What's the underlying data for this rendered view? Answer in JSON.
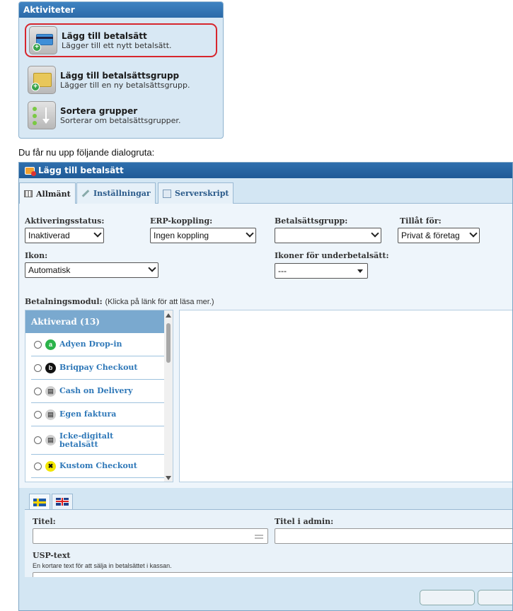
{
  "activities": {
    "header": "Aktiviteter",
    "items": [
      {
        "title": "Lägg till betalsätt",
        "desc": "Lägger till ett nytt betalsätt.",
        "icon": "card-add-icon"
      },
      {
        "title": "Lägg till betalsättsgrupp",
        "desc": "Lägger till en ny betalsättsgrupp.",
        "icon": "folder-add-icon"
      },
      {
        "title": "Sortera grupper",
        "desc": "Sorterar om betalsättsgrupper.",
        "icon": "sort-icon"
      }
    ]
  },
  "intro_text": "Du får nu upp följande dialogruta:",
  "dialog": {
    "title": "Lägg till betalsätt",
    "tabs": [
      {
        "label": "Allmänt",
        "icon": "grid-icon"
      },
      {
        "label": "Inställningar",
        "icon": "wrench-icon"
      },
      {
        "label": "Serverskript",
        "icon": "script-icon"
      }
    ],
    "fields": {
      "activation_label": "Aktiveringsstatus:",
      "activation_value": "Inaktiverad",
      "erp_label": "ERP-koppling:",
      "erp_value": "Ingen koppling",
      "group_label": "Betalsättsgrupp:",
      "group_value": "",
      "allow_label": "Tillåt för:",
      "allow_value": "Privat & företag",
      "icon_label": "Ikon:",
      "icon_value": "Automatisk",
      "sub_icons_label": "Ikoner för underbetalsätt:",
      "sub_icons_value": "---"
    },
    "module": {
      "label": "Betalningsmodul:",
      "hint": "(Klicka på länk för att läsa mer.)",
      "list_header": "Aktiverad (13)",
      "items": [
        {
          "name": "Adyen Drop-in",
          "logo_color": "#2bb34a",
          "logo_text": "a"
        },
        {
          "name": "Briqpay Checkout",
          "logo_color": "#111111",
          "logo_text": "b"
        },
        {
          "name": "Cash on Delivery",
          "logo_color": "#cfcfcf",
          "logo_text": "▤"
        },
        {
          "name": "Egen faktura",
          "logo_color": "#cfcfcf",
          "logo_text": "▤"
        },
        {
          "name": "Icke-digitalt betalsätt",
          "logo_color": "#cfcfcf",
          "logo_text": "▤"
        },
        {
          "name": "Kustom Checkout",
          "logo_color": "#f2e600",
          "logo_text": "✖"
        }
      ]
    },
    "lang": {
      "title_label": "Titel:",
      "admin_title_label": "Titel i admin:",
      "usp_label": "USP-text",
      "usp_hint": "En kortare text för att sälja in betalsättet i kassan."
    }
  }
}
